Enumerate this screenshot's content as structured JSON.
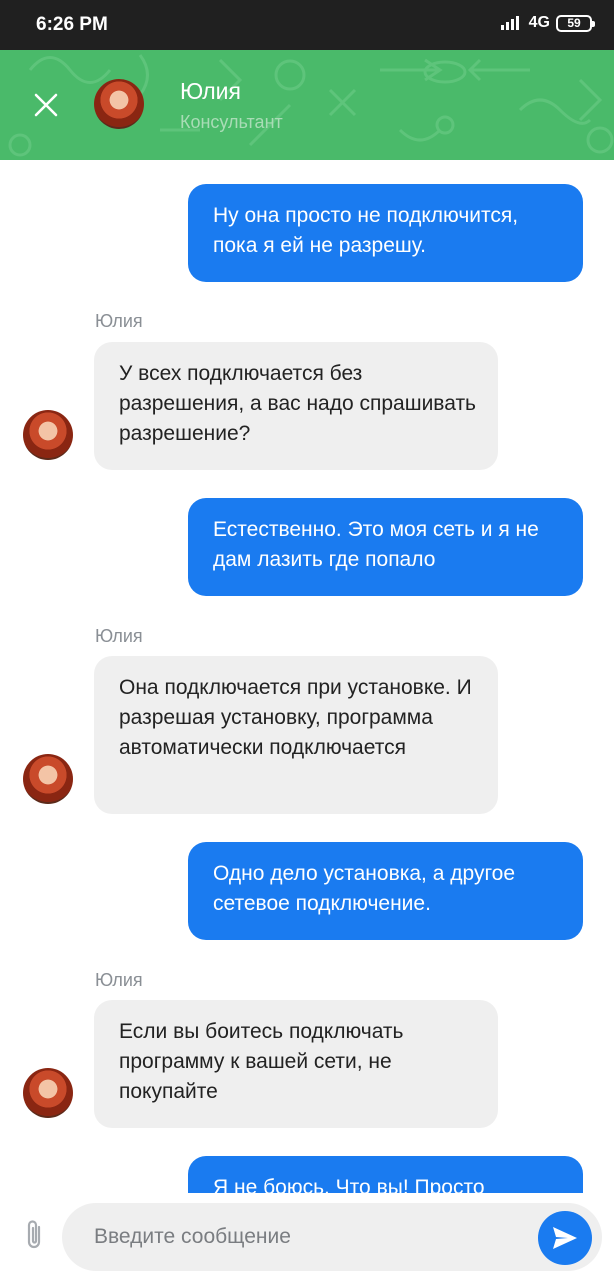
{
  "status_bar": {
    "time": "6:26 PM",
    "network": "4G",
    "battery": "59"
  },
  "header": {
    "name": "Юлия",
    "role": "Консультант",
    "close_icon": "close-icon",
    "background_color": "#4aba6a"
  },
  "messages": [
    {
      "direction": "outgoing",
      "text": "Ну она просто не подключится, пока я ей не разрешу."
    },
    {
      "direction": "incoming",
      "sender": "Юлия",
      "text": "У всех подключается без разрешения, а вас надо спрашивать разрешение?"
    },
    {
      "direction": "outgoing",
      "text": "Естественно. Это моя сеть и я не дам лазить где попало"
    },
    {
      "direction": "incoming",
      "sender": "Юлия",
      "text": "Она подключается при установке. И разрешая установку, программа автоматически подключается"
    },
    {
      "direction": "outgoing",
      "text": "Одно дело установка, а другое сетевое подключение."
    },
    {
      "direction": "incoming",
      "sender": "Юлия",
      "text": "Если вы боитесь подключать программу к вашей сети, не покупайте"
    },
    {
      "direction": "outgoing",
      "text": "Я не боюсь. Что вы! Просто"
    }
  ],
  "composer": {
    "placeholder": "Введите сообщение",
    "attach_icon": "paperclip-icon",
    "send_icon": "send-icon"
  },
  "colors": {
    "outgoing_bubble": "#1a7bf0",
    "incoming_bubble": "#efefef",
    "accent": "#1a7bf0"
  }
}
